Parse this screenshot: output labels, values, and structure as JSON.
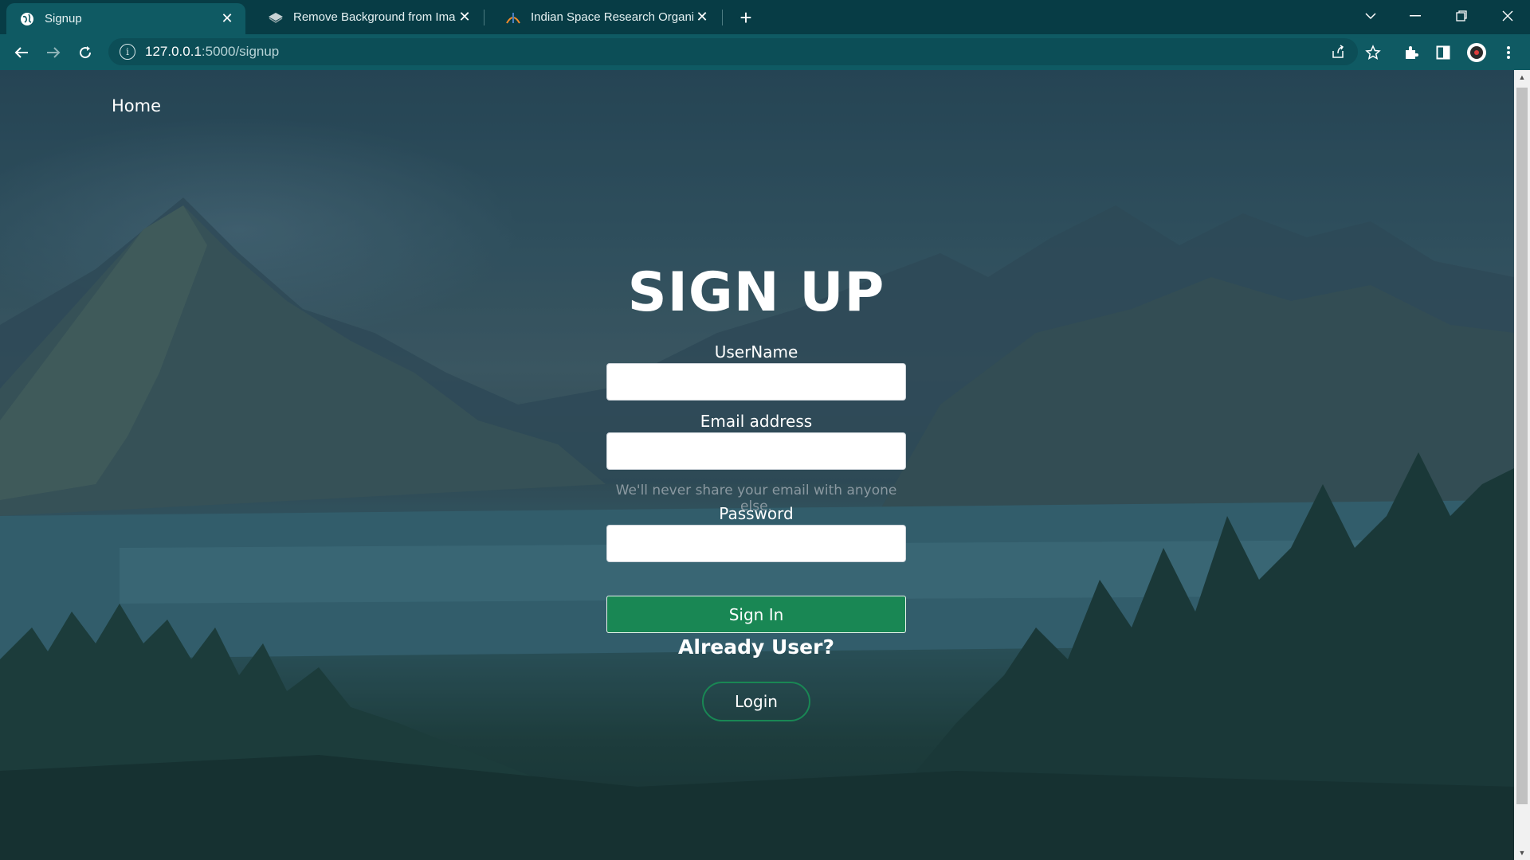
{
  "browser": {
    "tabs": [
      {
        "title": "Signup",
        "icon": "globe-icon",
        "active": true
      },
      {
        "title": "Remove Background from Image",
        "icon": "layers-icon",
        "active": false
      },
      {
        "title": "Indian Space Research Organisati",
        "icon": "isro-icon",
        "active": false
      }
    ],
    "url_host": "127.0.0.1",
    "url_path": ":5000/signup"
  },
  "nav": {
    "home_label": "Home"
  },
  "form": {
    "title": "SIGN UP",
    "username_label": "UserName",
    "username_value": "",
    "email_label": "Email address",
    "email_value": "",
    "email_help": "We'll never share your email with anyone else.",
    "password_label": "Password",
    "password_value": "",
    "submit_label": "Sign In",
    "already_text": "Already User?",
    "login_label": "Login"
  },
  "colors": {
    "chrome_bg": "#073c45",
    "toolbar_bg": "#0f5a63",
    "primary_green": "#198754"
  }
}
